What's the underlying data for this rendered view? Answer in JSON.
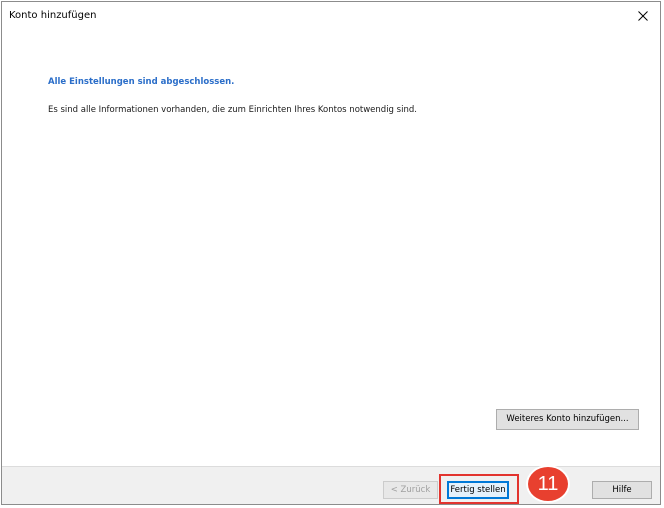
{
  "window": {
    "title": "Konto hinzufügen"
  },
  "content": {
    "heading": "Alle Einstellungen sind abgeschlossen.",
    "info": "Es sind alle Informationen vorhanden, die zum Einrichten Ihres Kontos notwendig sind.",
    "add_account_label": "Weiteres Konto hinzufügen..."
  },
  "footer": {
    "back_label": "< Zurück",
    "finish_label": "Fertig stellen",
    "help_label": "Hilfe"
  },
  "annotation": {
    "step_number": "11",
    "badge_color": "#e8402f",
    "highlight_color": "#e2332e"
  },
  "colors": {
    "heading_accent": "#2b6ec9",
    "focus_border": "#0078d7"
  }
}
